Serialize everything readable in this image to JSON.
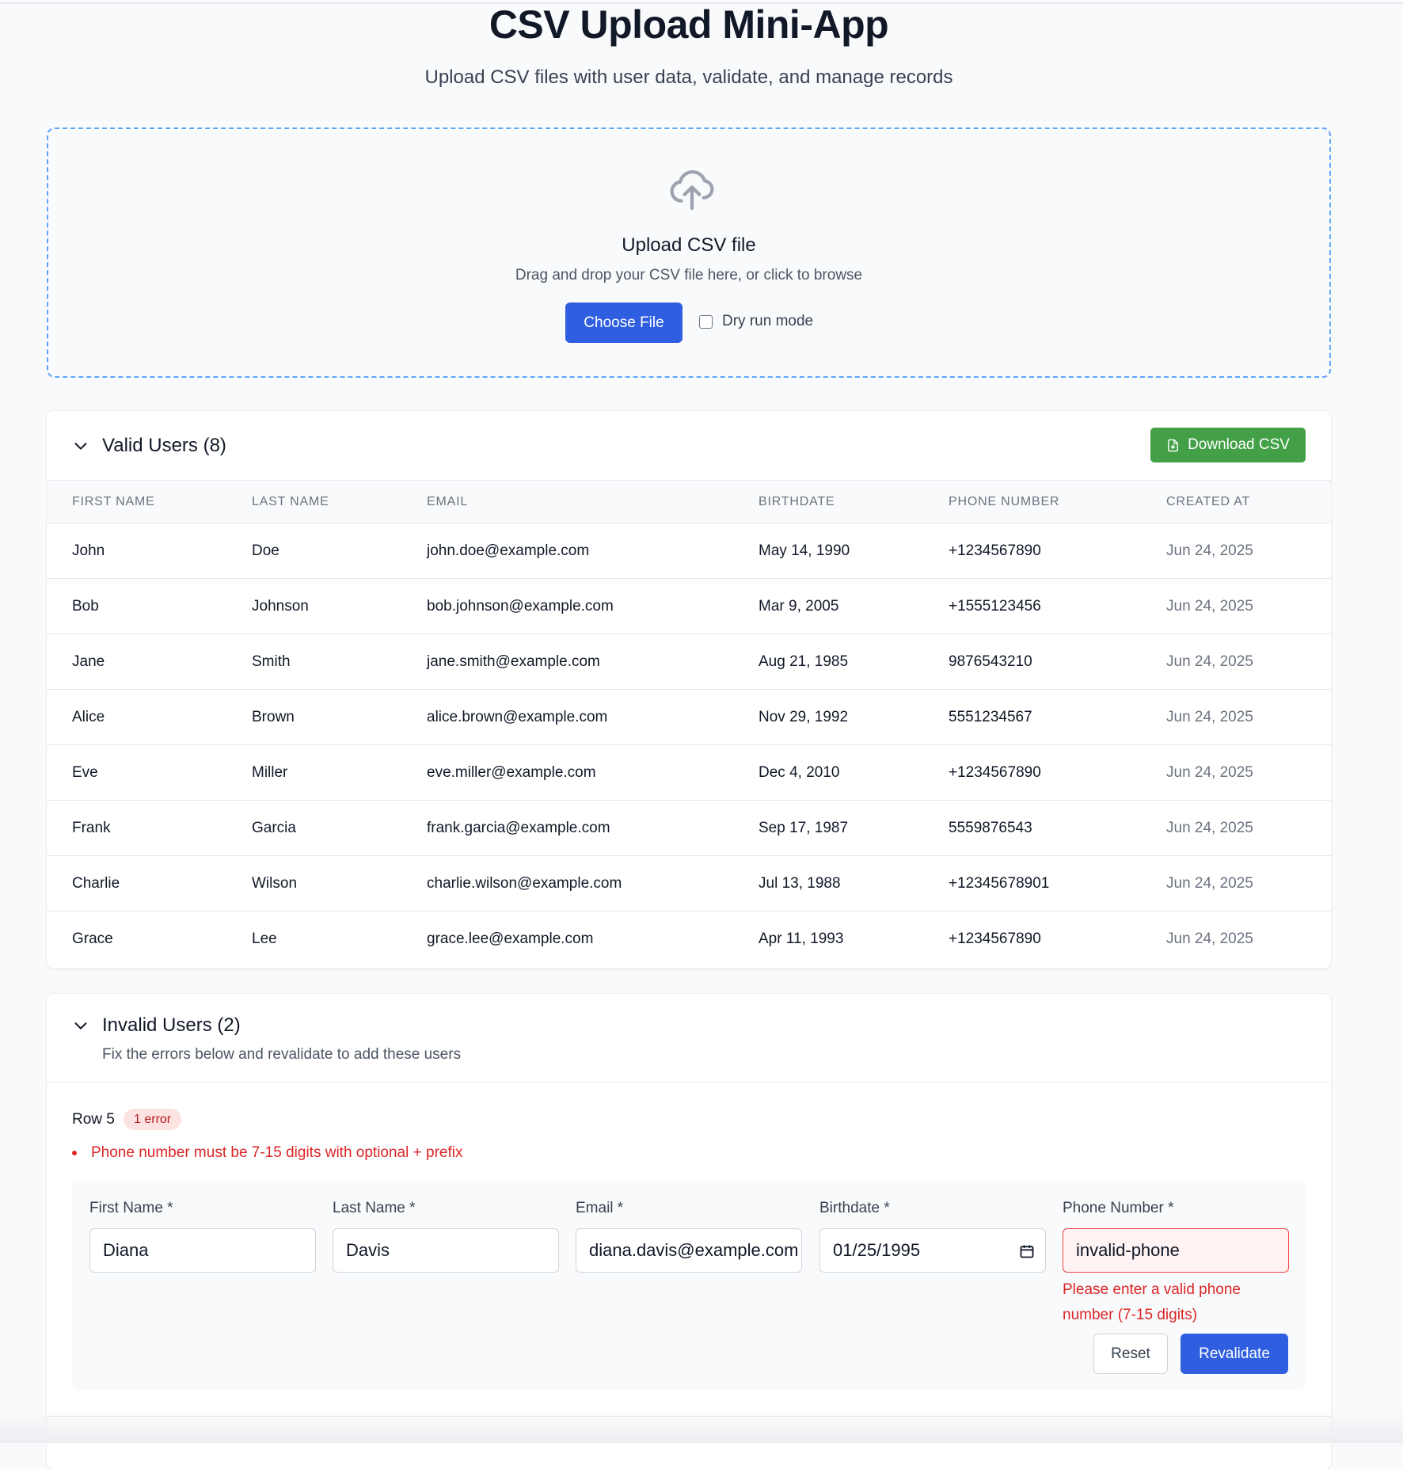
{
  "header": {
    "title": "CSV Upload Mini-App",
    "subtitle": "Upload CSV files with user data, validate, and manage records"
  },
  "upload": {
    "icon": "cloud-upload-icon",
    "title": "Upload CSV file",
    "hint": "Drag and drop your CSV file here, or click to browse",
    "choose_label": "Choose File",
    "dry_run_label": "Dry run mode",
    "dry_run_checked": false
  },
  "valid_users": {
    "title": "Valid Users (8)",
    "download_label": "Download CSV",
    "columns": [
      "FIRST NAME",
      "LAST NAME",
      "EMAIL",
      "BIRTHDATE",
      "PHONE NUMBER",
      "CREATED AT"
    ],
    "rows": [
      [
        "John",
        "Doe",
        "john.doe@example.com",
        "May 14, 1990",
        "+1234567890",
        "Jun 24, 2025"
      ],
      [
        "Bob",
        "Johnson",
        "bob.johnson@example.com",
        "Mar 9, 2005",
        "+1555123456",
        "Jun 24, 2025"
      ],
      [
        "Jane",
        "Smith",
        "jane.smith@example.com",
        "Aug 21, 1985",
        "9876543210",
        "Jun 24, 2025"
      ],
      [
        "Alice",
        "Brown",
        "alice.brown@example.com",
        "Nov 29, 1992",
        "5551234567",
        "Jun 24, 2025"
      ],
      [
        "Eve",
        "Miller",
        "eve.miller@example.com",
        "Dec 4, 2010",
        "+1234567890",
        "Jun 24, 2025"
      ],
      [
        "Frank",
        "Garcia",
        "frank.garcia@example.com",
        "Sep 17, 1987",
        "5559876543",
        "Jun 24, 2025"
      ],
      [
        "Charlie",
        "Wilson",
        "charlie.wilson@example.com",
        "Jul 13, 1988",
        "+12345678901",
        "Jun 24, 2025"
      ],
      [
        "Grace",
        "Lee",
        "grace.lee@example.com",
        "Apr 11, 1993",
        "+1234567890",
        "Jun 24, 2025"
      ]
    ]
  },
  "invalid_users": {
    "title": "Invalid Users (2)",
    "description": "Fix the errors below and revalidate to add these users",
    "entry": {
      "row_label": "Row 5",
      "badge": "1 error",
      "errors": [
        "Phone number must be 7-15 digits with optional + prefix"
      ],
      "fields": {
        "first_name": {
          "label": "First Name *",
          "value": "Diana"
        },
        "last_name": {
          "label": "Last Name *",
          "value": "Davis"
        },
        "email": {
          "label": "Email *",
          "value": "diana.davis@example.com"
        },
        "birthdate": {
          "label": "Birthdate *",
          "value": "01/25/1995"
        },
        "phone": {
          "label": "Phone Number *",
          "value": "invalid-phone",
          "error": "Please enter a valid phone number (7-15 digits)"
        }
      },
      "reset_label": "Reset",
      "revalidate_label": "Revalidate"
    }
  },
  "colors": {
    "primary": "#2f5fe0",
    "success": "#43a047",
    "error": "#dc2626",
    "dropzone_border": "#60a5fa"
  }
}
